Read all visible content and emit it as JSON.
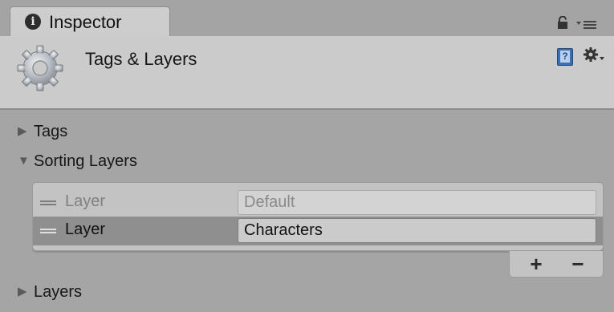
{
  "window": {
    "tab_label": "Inspector",
    "icons": {
      "tab": "info-icon",
      "lock": "lock-icon",
      "menu": "context-menu-icon"
    }
  },
  "header": {
    "title": "Tags & Layers",
    "icons": {
      "main": "gear-icon",
      "help": "help-book-icon",
      "settings": "settings-gear-icon"
    }
  },
  "sections": {
    "tags": {
      "label": "Tags",
      "expanded": false
    },
    "sorting_layers": {
      "label": "Sorting Layers",
      "expanded": true,
      "rows": [
        {
          "label": "Layer",
          "value": "Default",
          "selected": false,
          "editable": false
        },
        {
          "label": "Layer",
          "value": "Characters",
          "selected": true,
          "editable": true
        }
      ],
      "add_label": "+",
      "remove_label": "−"
    },
    "layers": {
      "label": "Layers",
      "expanded": false
    }
  },
  "colors": {
    "background": "#a5a5a5",
    "header": "#cbcbcb",
    "selected_row": "#8f8f8f"
  }
}
